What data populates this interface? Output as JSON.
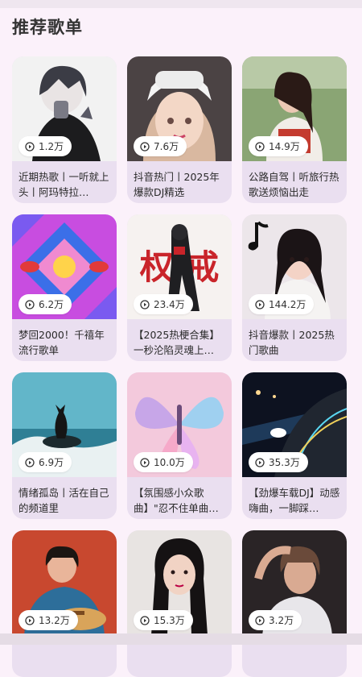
{
  "section": {
    "title": "推荐歌单"
  },
  "playlists": [
    {
      "plays": "1.2万",
      "title": "近期热歌丨一听就上头丨阿玛特拉…",
      "cover": "anime-boy"
    },
    {
      "plays": "7.6万",
      "title": "抖音热门丨2025年爆款DJ精选",
      "cover": "headphones-girl"
    },
    {
      "plays": "14.9万",
      "title": "公路自驾丨听旅行热歌送烦恼出走",
      "cover": "roadtrip-girl"
    },
    {
      "plays": "6.2万",
      "title": "梦回2000！千禧年流行歌单",
      "cover": "kaleidoscope"
    },
    {
      "plays": "23.4万",
      "title": "【2025热梗合集】一秒沦陷灵魂上…",
      "cover": "hero-text",
      "cover_text": "权 戒"
    },
    {
      "plays": "144.2万",
      "title": "抖音爆款丨2025热门歌曲",
      "cover": "tiktok-girl"
    },
    {
      "plays": "6.9万",
      "title": "情绪孤岛丨活在自己的频道里",
      "cover": "cat-sea"
    },
    {
      "plays": "10.0万",
      "title": "【氛围感小众歌曲】\"忍不住单曲…",
      "cover": "butterfly"
    },
    {
      "plays": "35.3万",
      "title": "【劲爆车载DJ】动感嗨曲，一脚踩…",
      "cover": "car-night"
    },
    {
      "plays": "13.2万",
      "title": "",
      "cover": "guitar-singer"
    },
    {
      "plays": "15.3万",
      "title": "",
      "cover": "retro-girl"
    },
    {
      "plays": "3.2万",
      "title": "",
      "cover": "dark-portrait"
    }
  ],
  "icons": {
    "play": "play-circle-icon"
  }
}
